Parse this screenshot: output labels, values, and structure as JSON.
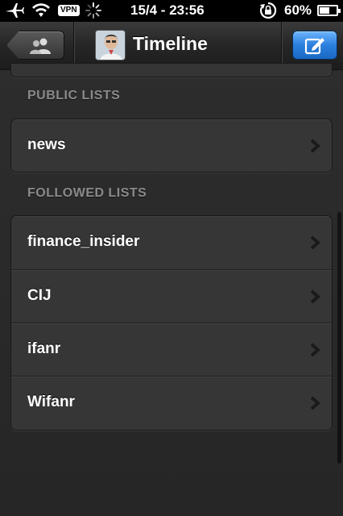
{
  "status_bar": {
    "vpn": "VPN",
    "time": "15/4 - 23:56",
    "battery": "60%",
    "battery_level": 0.6,
    "icons": [
      "airplane-icon",
      "wifi-icon",
      "activity-spinner-icon",
      "rotation-lock-icon",
      "battery-icon"
    ]
  },
  "nav_bar": {
    "title": "Timeline",
    "back_icon": "people-icon",
    "compose_icon": "compose-icon",
    "accent_color": "#2b7fdc"
  },
  "sections": [
    {
      "header": "PUBLIC LISTS",
      "items": [
        {
          "label": "news"
        }
      ]
    },
    {
      "header": "FOLLOWED LISTS",
      "items": [
        {
          "label": "finance_insider"
        },
        {
          "label": "CIJ"
        },
        {
          "label": "ifanr"
        },
        {
          "label": "Wifanr"
        }
      ]
    }
  ]
}
